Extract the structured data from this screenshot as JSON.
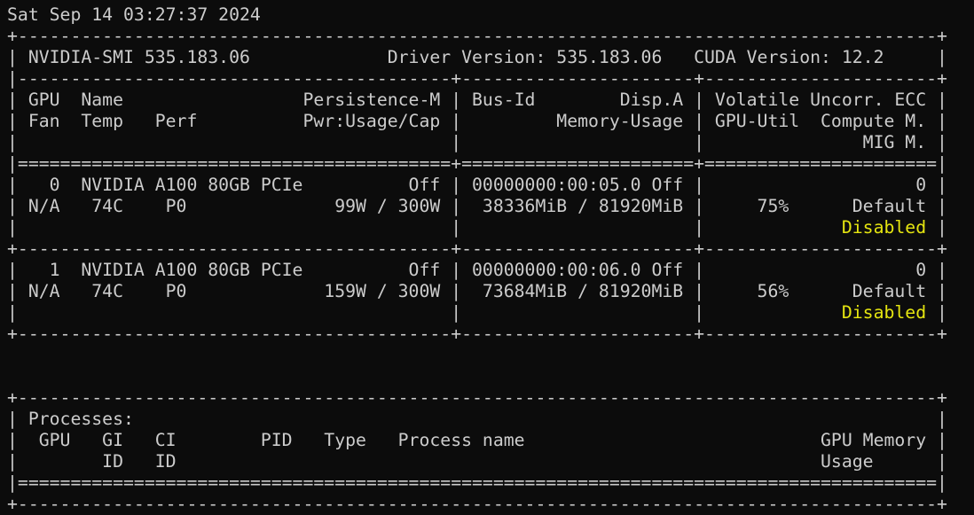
{
  "terminal": {
    "lines": [
      [
        "Sat Sep 14 03:27:37 2024"
      ],
      [
        "+---------------------------------------------------------------------------------------+"
      ],
      [
        "| NVIDIA-SMI 535.183.06             Driver Version: 535.183.06   CUDA Version: 12.2     |"
      ],
      [
        "|-----------------------------------------+----------------------+----------------------+"
      ],
      [
        "| GPU  Name                 Persistence-M | Bus-Id        Disp.A | Volatile Uncorr. ECC |"
      ],
      [
        "| Fan  Temp   Perf          Pwr:Usage/Cap |         Memory-Usage | GPU-Util  Compute M. |"
      ],
      [
        "|                                         |                      |               MIG M. |"
      ],
      [
        "|=========================================+======================+======================|"
      ],
      [
        "|   0  NVIDIA A100 80GB PCIe          Off | 00000000:00:05.0 Off |                    0 |"
      ],
      [
        "| N/A   74C    P0              99W / 300W |  38336MiB / 81920MiB |     75%      Default |"
      ],
      [
        "|                                         |                      |             ",
        "Disabled",
        " |"
      ],
      [
        "+-----------------------------------------+----------------------+----------------------+"
      ],
      [
        "|   1  NVIDIA A100 80GB PCIe          Off | 00000000:00:06.0 Off |                    0 |"
      ],
      [
        "| N/A   74C    P0             159W / 300W |  73684MiB / 81920MiB |     56%      Default |"
      ],
      [
        "|                                         |                      |             ",
        "Disabled",
        " |"
      ],
      [
        "+-----------------------------------------+----------------------+----------------------+"
      ],
      [
        ""
      ],
      [
        ""
      ],
      [
        "+---------------------------------------------------------------------------------------+"
      ],
      [
        "| Processes:                                                                            |"
      ],
      [
        "|  GPU   GI   CI        PID   Type   Process name                            GPU Memory |"
      ],
      [
        "|        ID   ID                                                             Usage      |"
      ],
      [
        "|=======================================================================================|"
      ],
      [
        "+---------------------------------------------------------------------------------------+"
      ]
    ]
  },
  "colors": {
    "background": "#0c0c0c",
    "foreground": "#cccccc",
    "highlight": "#e5e510"
  }
}
